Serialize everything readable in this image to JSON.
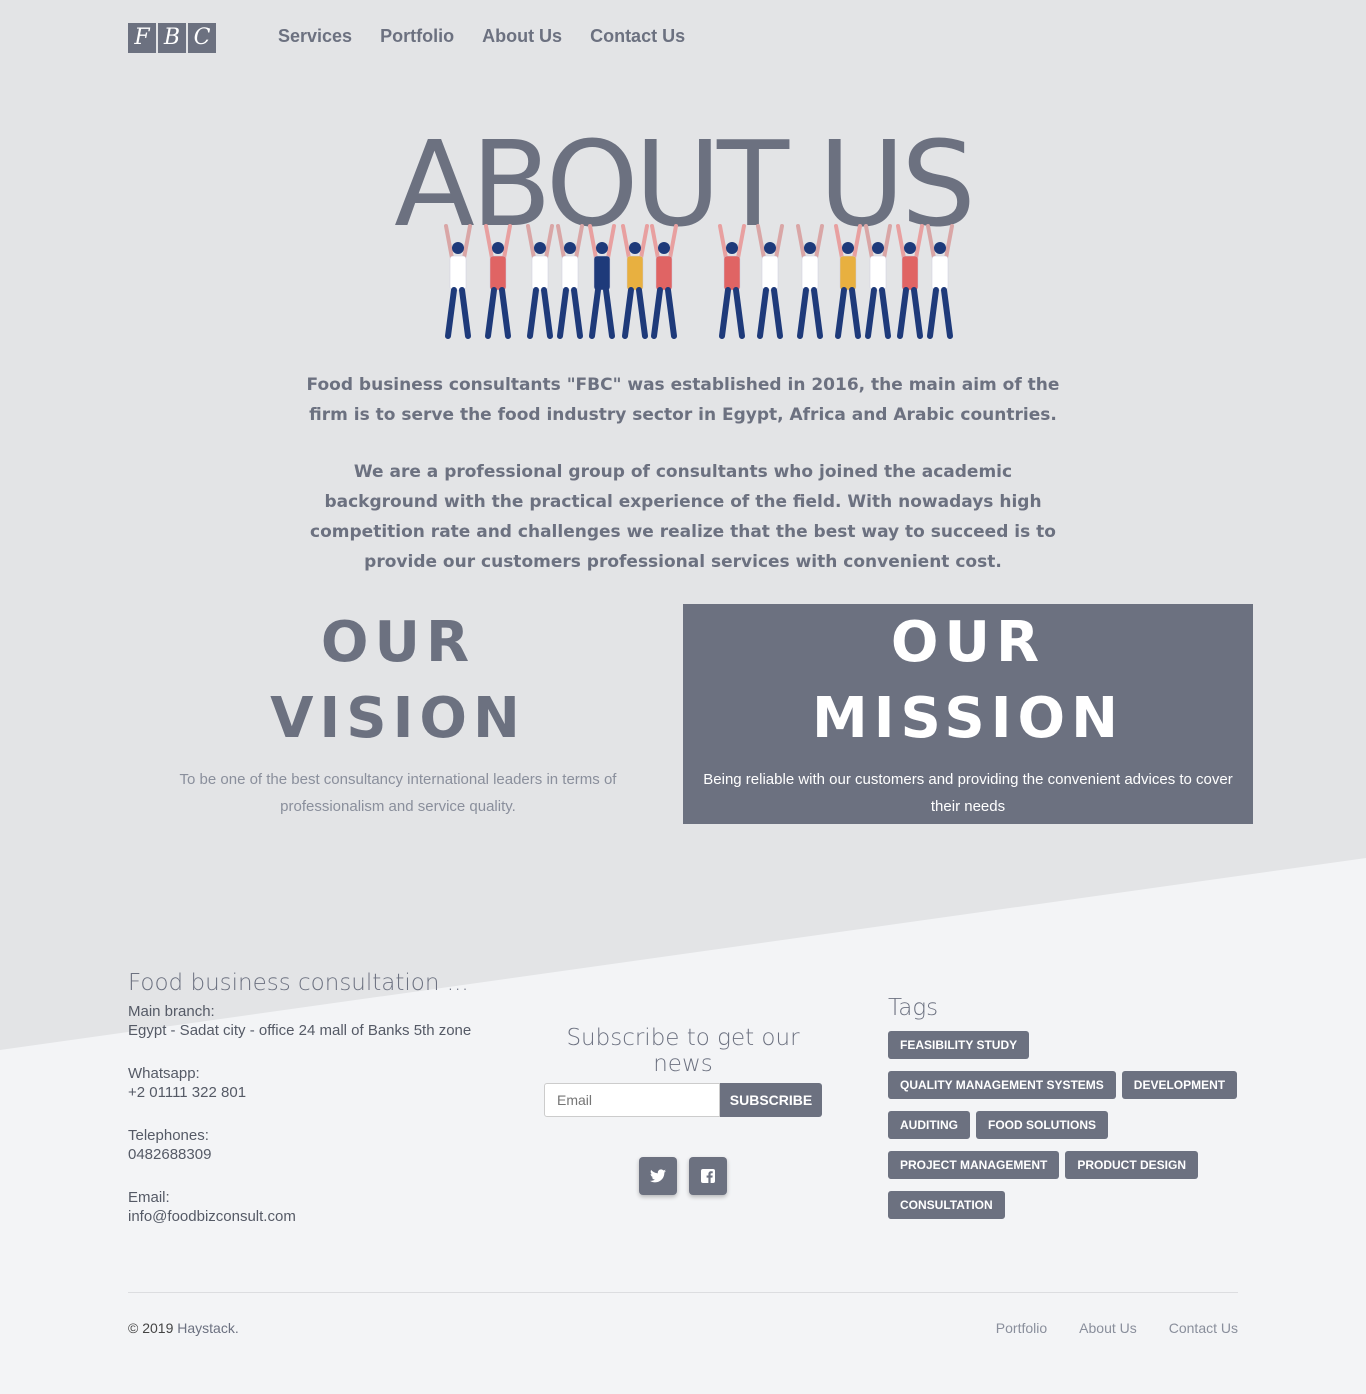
{
  "logo": {
    "letters": [
      "F",
      "B",
      "C"
    ]
  },
  "nav": [
    {
      "label": "Services"
    },
    {
      "label": "Portfolio"
    },
    {
      "label": "About Us"
    },
    {
      "label": "Contact Us"
    }
  ],
  "hero": {
    "title": "ABOUT US"
  },
  "intro": {
    "p1": "Food business consultants \"FBC\" was established in 2016, the main aim of the firm is to serve the food industry sector in Egypt, Africa and Arabic countries.",
    "p2": "We are a professional group of consultants who joined the academic background with the practical experience of the field. With nowadays high competition rate and challenges we realize that the best way to succeed is to provide our customers professional services with convenient cost."
  },
  "vision": {
    "line1": "OUR",
    "line2": "VISION",
    "text": "To be one of the best consultancy international leaders in terms of professionalism and service quality."
  },
  "mission": {
    "line1": "OUR",
    "line2": "MISSION",
    "text": "Being reliable with our customers and providing the convenient advices to cover their needs"
  },
  "footer": {
    "title": "Food business consultation ...",
    "branch_label": "Main branch:",
    "branch_value": "Egypt - Sadat city - office 24 mall of Banks 5th zone",
    "whatsapp_label": "Whatsapp:",
    "whatsapp_value": "+2 01111 322 801",
    "tel_label": "Telephones:",
    "tel_value": "0482688309",
    "email_label": "Email:",
    "email_value": "info@foodbizconsult.com"
  },
  "subscribe": {
    "title": "Subscribe to get our news",
    "placeholder": "Email",
    "button": "SUBSCRIBE"
  },
  "social": [
    "twitter-icon",
    "facebook-icon"
  ],
  "tags": {
    "title": "Tags",
    "items": [
      "FEASIBILITY STUDY",
      "QUALITY MANAGEMENT SYSTEMS",
      "DEVELOPMENT",
      "AUDITING",
      "FOOD SOLUTIONS",
      "PROJECT MANAGEMENT",
      "PRODUCT DESIGN",
      "CONSULTATION"
    ]
  },
  "bottom": {
    "copyright_prefix": "© 2019",
    "copyright_name": "Haystack.",
    "links": [
      "Portfolio",
      "About Us",
      "Contact Us"
    ]
  },
  "colors": {
    "primary": "#6c7180",
    "bg_top": "#e3e4e6",
    "bg_bottom": "#f3f4f6"
  }
}
